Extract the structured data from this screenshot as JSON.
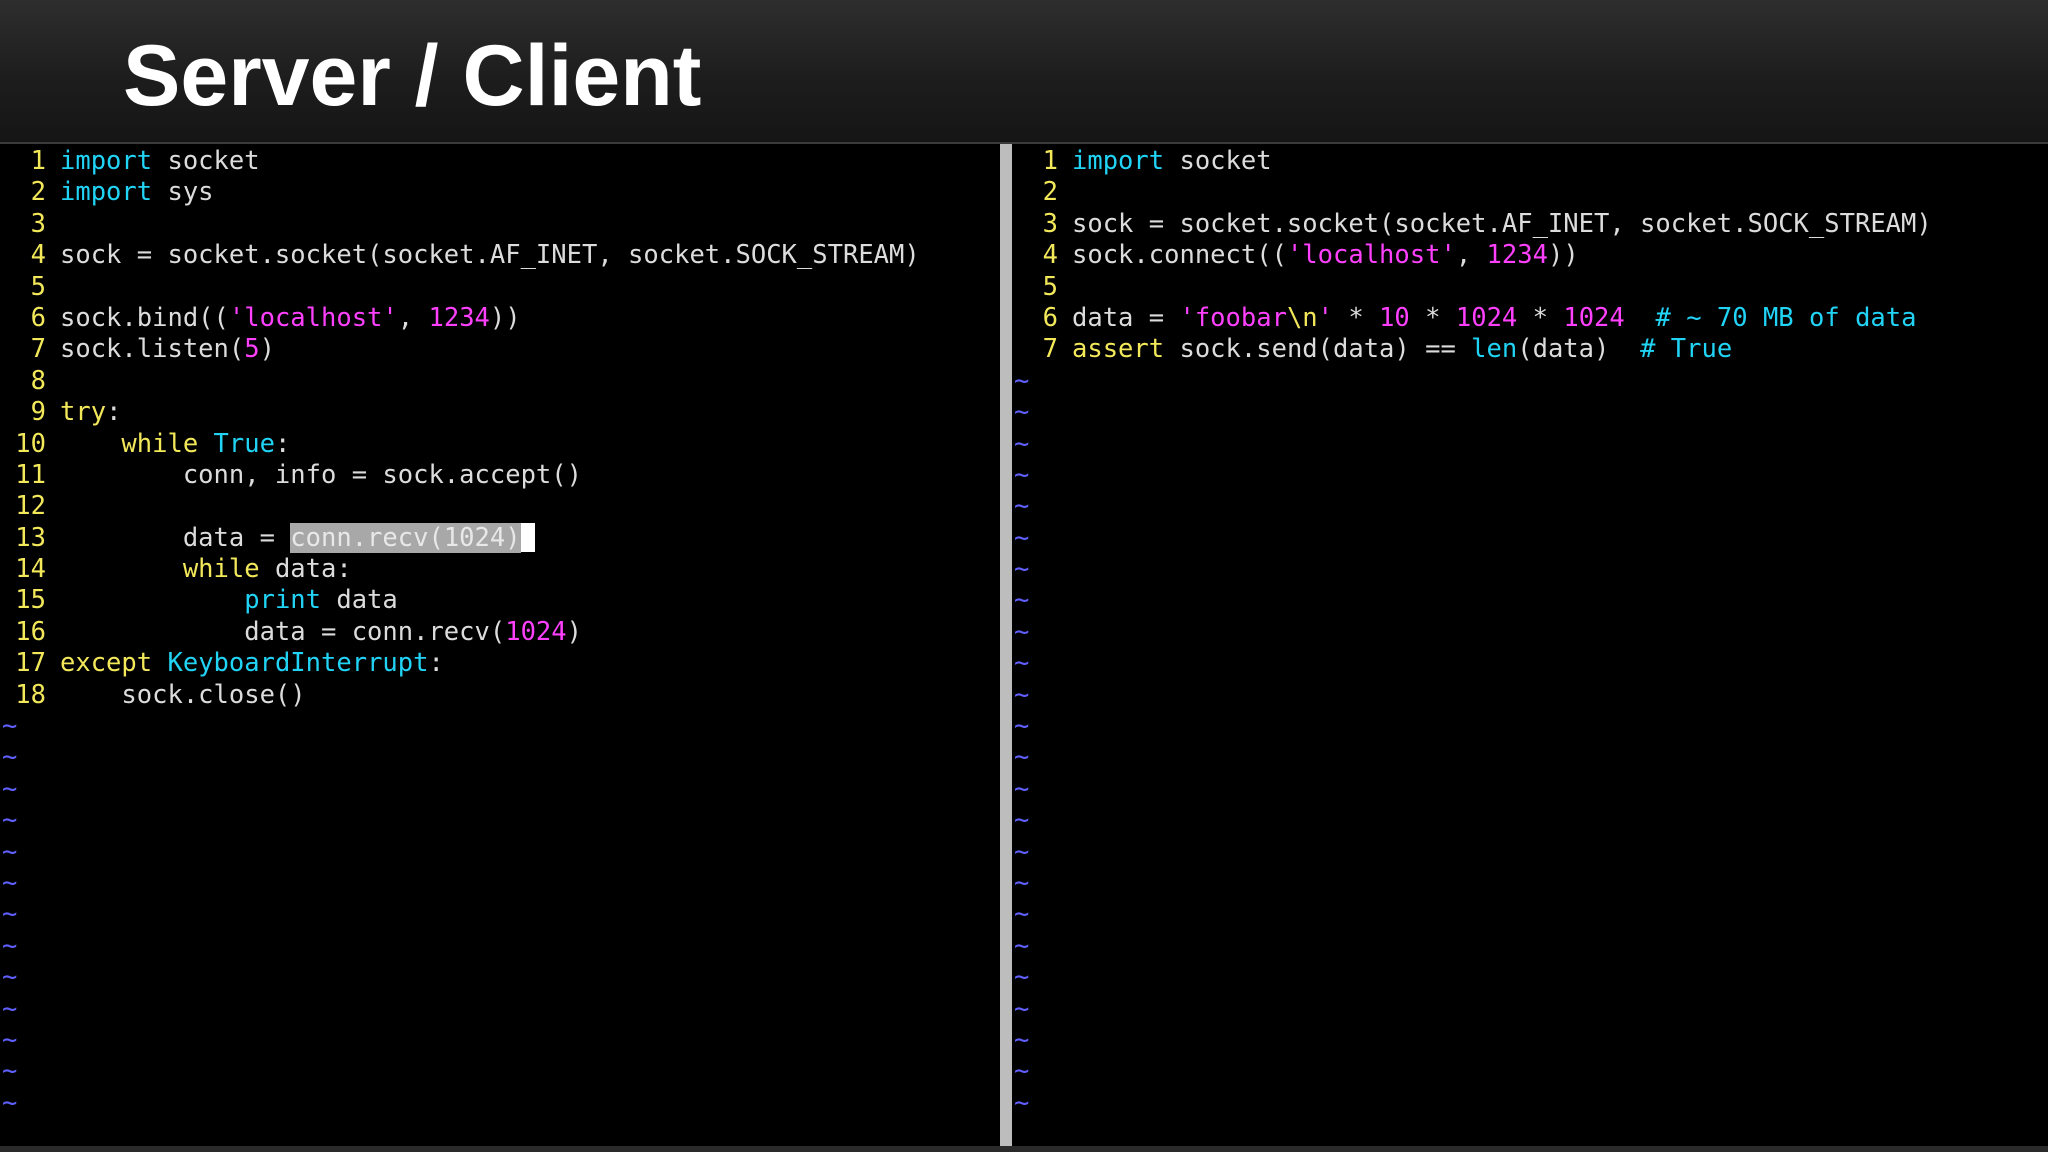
{
  "title": "Server / Client",
  "colors": {
    "keyword_cyan": "#21d3f5",
    "keyword_yellow": "#f2e85a",
    "string_magenta": "#ff40ff",
    "line_number": "#f2e85a",
    "tilde": "#6060ff",
    "code_text": "#dcdcdc",
    "visual_selection": "#a8a8a8"
  },
  "server": {
    "lines": [
      {
        "n": "1",
        "segs": [
          {
            "t": "import",
            "c": "kw"
          },
          {
            "t": " socket"
          }
        ]
      },
      {
        "n": "2",
        "segs": [
          {
            "t": "import",
            "c": "kw"
          },
          {
            "t": " sys"
          }
        ]
      },
      {
        "n": "3",
        "segs": []
      },
      {
        "n": "4",
        "segs": [
          {
            "t": "sock = socket.socket(socket.AF_INET, socket.SOCK_STREAM)"
          }
        ]
      },
      {
        "n": "5",
        "segs": []
      },
      {
        "n": "6",
        "segs": [
          {
            "t": "sock.bind(("
          },
          {
            "t": "'localhost'",
            "c": "str"
          },
          {
            "t": ", "
          },
          {
            "t": "1234",
            "c": "num"
          },
          {
            "t": "))"
          }
        ]
      },
      {
        "n": "7",
        "segs": [
          {
            "t": "sock.listen("
          },
          {
            "t": "5",
            "c": "num"
          },
          {
            "t": ")"
          }
        ]
      },
      {
        "n": "8",
        "segs": []
      },
      {
        "n": "9",
        "segs": [
          {
            "t": "try",
            "c": "kw2"
          },
          {
            "t": ":"
          }
        ]
      },
      {
        "n": "10",
        "segs": [
          {
            "t": "    "
          },
          {
            "t": "while",
            "c": "kw2"
          },
          {
            "t": " "
          },
          {
            "t": "True",
            "c": "kw"
          },
          {
            "t": ":"
          }
        ]
      },
      {
        "n": "11",
        "segs": [
          {
            "t": "        conn, info = sock.accept()"
          }
        ]
      },
      {
        "n": "12",
        "segs": []
      },
      {
        "n": "13",
        "segs": [
          {
            "t": "        data = "
          },
          {
            "t": "conn.recv(",
            "c": "visual"
          },
          {
            "t": "1024",
            "c": "visual-num"
          },
          {
            "t": ")",
            "c": "visual"
          },
          {
            "t": "",
            "c": "cursor"
          }
        ]
      },
      {
        "n": "14",
        "segs": [
          {
            "t": "        "
          },
          {
            "t": "while",
            "c": "kw2"
          },
          {
            "t": " data:"
          }
        ]
      },
      {
        "n": "15",
        "segs": [
          {
            "t": "            "
          },
          {
            "t": "print",
            "c": "kw"
          },
          {
            "t": " data"
          }
        ]
      },
      {
        "n": "16",
        "segs": [
          {
            "t": "            data = conn.recv("
          },
          {
            "t": "1024",
            "c": "num"
          },
          {
            "t": ")"
          }
        ]
      },
      {
        "n": "17",
        "segs": [
          {
            "t": "except",
            "c": "kw2"
          },
          {
            "t": " "
          },
          {
            "t": "KeyboardInterrupt",
            "c": "cls"
          },
          {
            "t": ":"
          }
        ]
      },
      {
        "n": "18",
        "segs": [
          {
            "t": "    sock.close()"
          }
        ]
      }
    ],
    "tilde_count": 13
  },
  "client": {
    "lines": [
      {
        "n": "1",
        "segs": [
          {
            "t": "import",
            "c": "kw"
          },
          {
            "t": " socket"
          }
        ]
      },
      {
        "n": "2",
        "segs": []
      },
      {
        "n": "3",
        "segs": [
          {
            "t": "sock = socket.socket(socket.AF_INET, socket.SOCK_STREAM)"
          }
        ]
      },
      {
        "n": "4",
        "segs": [
          {
            "t": "sock.connect(("
          },
          {
            "t": "'localhost'",
            "c": "str"
          },
          {
            "t": ", "
          },
          {
            "t": "1234",
            "c": "num"
          },
          {
            "t": "))"
          }
        ]
      },
      {
        "n": "5",
        "segs": []
      },
      {
        "n": "6",
        "segs": [
          {
            "t": "data = "
          },
          {
            "t": "'foobar",
            "c": "str"
          },
          {
            "t": "\\n",
            "c": "kw2"
          },
          {
            "t": "'",
            "c": "str"
          },
          {
            "t": " * "
          },
          {
            "t": "10",
            "c": "num"
          },
          {
            "t": " * "
          },
          {
            "t": "1024",
            "c": "num"
          },
          {
            "t": " * "
          },
          {
            "t": "1024",
            "c": "num"
          },
          {
            "t": "  "
          },
          {
            "t": "# ~ 70 MB of data",
            "c": "cmt"
          }
        ]
      },
      {
        "n": "7",
        "segs": [
          {
            "t": "assert",
            "c": "kw2"
          },
          {
            "t": " sock.send(data) == "
          },
          {
            "t": "len",
            "c": "kw"
          },
          {
            "t": "(data)  "
          },
          {
            "t": "# True",
            "c": "cmt"
          }
        ]
      }
    ],
    "tilde_count": 24
  }
}
